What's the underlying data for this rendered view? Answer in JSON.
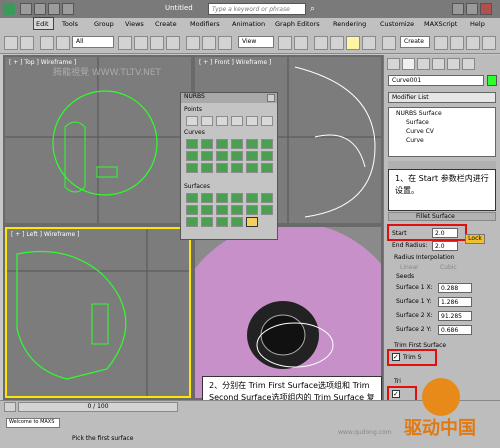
{
  "titlebar": {
    "document": "Untitled",
    "search_placeholder": "Type a keyword or phrase"
  },
  "menu": [
    "Edit",
    "Tools",
    "Group",
    "Views",
    "Create",
    "Modifiers",
    "Animation",
    "Graph Editors",
    "Rendering",
    "Customize",
    "MAXScript",
    "Help"
  ],
  "toolbar": {
    "selection_filter": "All",
    "reference_coord": "View",
    "named_selection": "Create"
  },
  "viewports": {
    "top": "[ + ] Top ] Wireframe ]",
    "front": "[ + ] Front ] Wireframe ]",
    "left": "[ + ] Left ] Wireframe ]",
    "persp_watermark": "腾龍視覺 WWW.TLTV.NET"
  },
  "nurbs_panel": {
    "title": "NURBS",
    "points_label": "Points",
    "curves_label": "Curves",
    "surfaces_label": "Surfaces"
  },
  "command_panel": {
    "object_name": "Curve001",
    "modifier_list": "Modifier List",
    "stack": [
      "NURBS Surface",
      "Surface",
      "Curve CV",
      "Curve"
    ],
    "rollout_title": "Fillet Surface",
    "start_label": "Start",
    "start_value": "2.0",
    "end_radius_label": "End Radius:",
    "end_radius_value": "2.0",
    "lock_label": "Lock",
    "radius_interp_label": "Radius Interpolation",
    "linear_label": "Linear",
    "cubic_label": "Cubic",
    "seeds_label": "Seeds",
    "seeds": [
      {
        "label": "Surface 1 X:",
        "value": "0.288"
      },
      {
        "label": "Surface 1 Y:",
        "value": "1.286"
      },
      {
        "label": "Surface 2 X:",
        "value": "91.285"
      },
      {
        "label": "Surface 2 Y:",
        "value": "0.686"
      }
    ],
    "trim_first_label": "Trim First Surface",
    "trim_surface_label": "Trim S",
    "trim_second_label": "Tri"
  },
  "callouts": {
    "step1": "1、在 Start 参数栏内进行设置。",
    "step2": "2、分别在 Trim First Surface选项组和 Trim Second Surface选项组内的 Trim Surface 复选框"
  },
  "status": {
    "welcome": "Welcome to MAXS",
    "prompt": "Pick the first surface",
    "time": "0 / 100"
  },
  "watermark": {
    "logo": "驱动中国",
    "site": "www.qudong.com"
  },
  "colors": {
    "viewport_bg": "#7c7c7c",
    "wire_green": "#2cff2c",
    "highlight_red": "#e01010",
    "persp_pink": "#c890c8"
  }
}
